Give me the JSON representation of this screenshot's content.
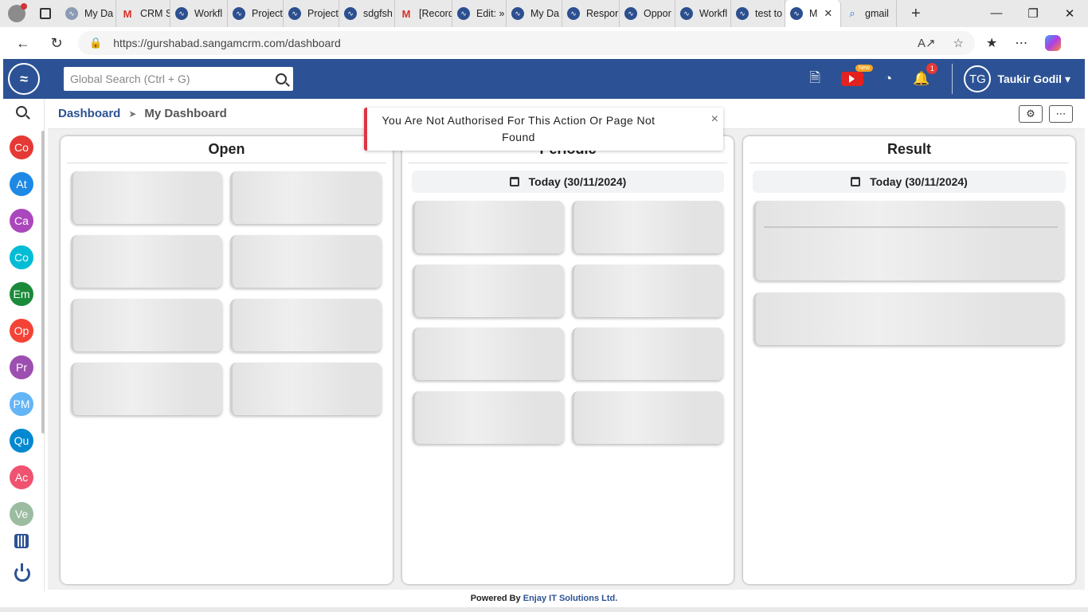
{
  "browser": {
    "tabs": [
      {
        "label": "My Da",
        "icon": "gray"
      },
      {
        "label": "CRM S",
        "icon": "gm"
      },
      {
        "label": "Workfl",
        "icon": "crm"
      },
      {
        "label": "Project",
        "icon": "crm"
      },
      {
        "label": "Project",
        "icon": "crm"
      },
      {
        "label": "sdgfsh",
        "icon": "crm"
      },
      {
        "label": "[Record",
        "icon": "gm"
      },
      {
        "label": "Edit: »",
        "icon": "crm"
      },
      {
        "label": "My Da",
        "icon": "crm"
      },
      {
        "label": "Respor",
        "icon": "crm"
      },
      {
        "label": "Oppor",
        "icon": "crm"
      },
      {
        "label": "Workfl",
        "icon": "crm"
      },
      {
        "label": "test to",
        "icon": "crm"
      },
      {
        "label": "M",
        "icon": "crm",
        "active": true
      },
      {
        "label": "gmail",
        "icon": "srch"
      }
    ],
    "url": "https://gurshabad.sangamcrm.com/dashboard"
  },
  "header": {
    "search_placeholder": "Global Search (Ctrl + G)",
    "youtube_badge": "New",
    "notification_count": "1",
    "user_initials": "TG",
    "user_name": "Taukir Godil"
  },
  "sidebar": {
    "items": [
      {
        "label": "Co",
        "color": "#e53935"
      },
      {
        "label": "At",
        "color": "#1e88e5"
      },
      {
        "label": "Ca",
        "color": "#ab47bc"
      },
      {
        "label": "Co",
        "color": "#00bcd4"
      },
      {
        "label": "Em",
        "color": "#1b8a3a"
      },
      {
        "label": "Op",
        "color": "#f44336"
      },
      {
        "label": "Pr",
        "color": "#9c4fb0"
      },
      {
        "label": "PM",
        "color": "#64b5f6"
      },
      {
        "label": "Qu",
        "color": "#0288d1"
      },
      {
        "label": "Ac",
        "color": "#ef5370"
      },
      {
        "label": "Ve",
        "color": "#9bbca0"
      }
    ]
  },
  "breadcrumb": {
    "root": "Dashboard",
    "current": "My Dashboard"
  },
  "panels": {
    "open_title": "Open",
    "periodic_title": "Periodic",
    "result_title": "Result",
    "periodic_date": "Today  (30/11/2024)",
    "result_date": "Today  (30/11/2024)"
  },
  "toast": {
    "message": "You Are Not Authorised For This Action Or Page Not Found",
    "accent": "#dc3545"
  },
  "footer": {
    "prefix": "Powered By ",
    "brand": "Enjay IT Solutions Ltd."
  },
  "colors": {
    "brand": "#2c5295"
  }
}
